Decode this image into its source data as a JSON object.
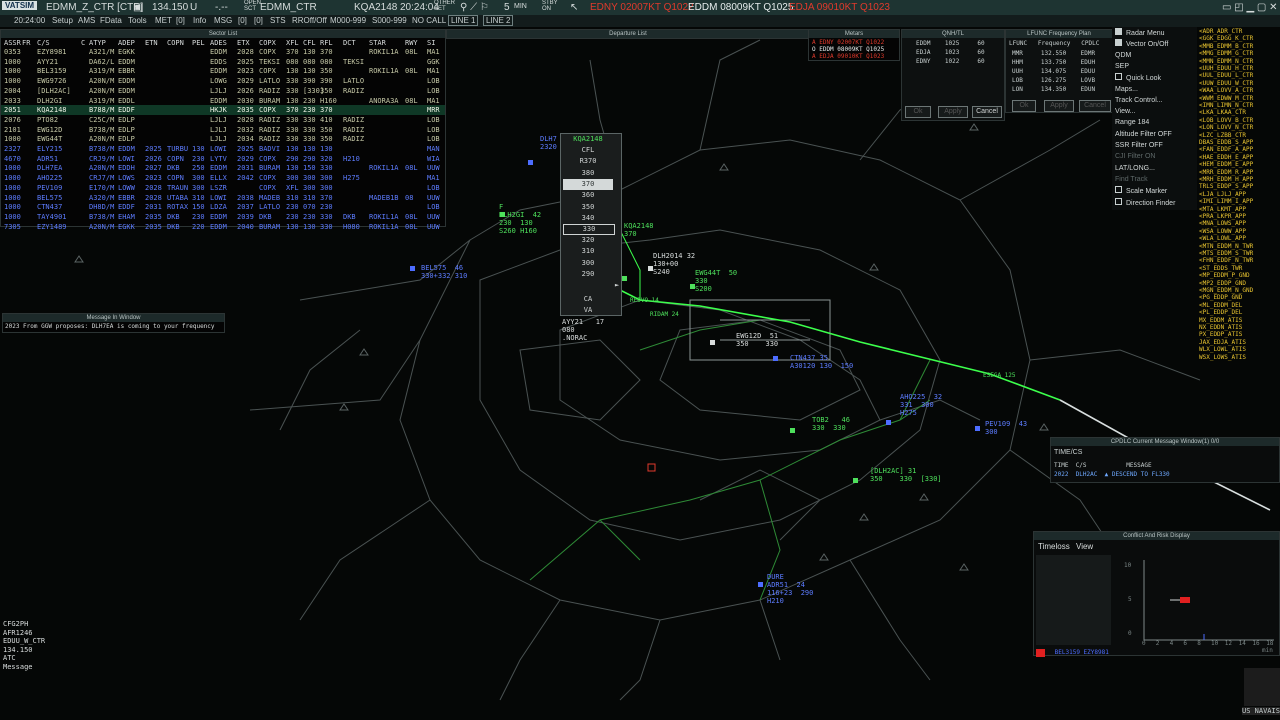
{
  "topbar": {
    "logo": "VATSIM",
    "position": "EDMM_Z_CTR [CTR]",
    "frequency": "134.150",
    "freq_unit": "U",
    "dash": "-.--",
    "sct": "EDMM_CTR",
    "callsign": "KQA2148",
    "time": "20:24:04",
    "qnh_ind": "5",
    "min": "MIN",
    "metars": [
      {
        "text": "EDNY 02007KT Q1022",
        "color": "#e03a2c"
      },
      {
        "text": "EDDM 08009KT Q1025",
        "color": "#e6ecec"
      },
      {
        "text": "EDJA 09010KT Q1023",
        "color": "#e03a2c"
      }
    ]
  },
  "menubar": {
    "utc": "20:24:00",
    "items": [
      "Setup",
      "AMS",
      "FData",
      "Tools",
      "MET",
      "[0]",
      "Info",
      "MSG",
      "[0]",
      "[0]",
      "STS",
      "RROff/Off",
      "M000-999",
      "S000-999",
      "NO CALL",
      "LINE 1",
      "LINE 2"
    ]
  },
  "sector_list": {
    "title": "Sector List",
    "headers": [
      "ASSR",
      "FR",
      "C/S",
      "C",
      "ATYP",
      "ADEP",
      "ETN",
      "COPN",
      "PEL",
      "ADES",
      "ETX",
      "COPX",
      "XFL",
      "CFL",
      "RFL",
      "DCT",
      "STAR",
      "RWY",
      "SI"
    ],
    "rows": [
      {
        "c": "w",
        "selected": false,
        "cells": [
          "0353",
          "",
          "EZY8981",
          "",
          "A321/M",
          "EGKK",
          "",
          "",
          "",
          "EDDM",
          "2028",
          "COPX",
          "370",
          "130",
          "370",
          "",
          "ROKIL1A",
          "08L",
          "MA1"
        ]
      },
      {
        "c": "w",
        "selected": false,
        "cells": [
          "1000",
          "",
          "AYY21",
          "",
          "DA62/L",
          "EDDM",
          "",
          "",
          "",
          "EDDS",
          "2025",
          "TEKSI",
          "080",
          "080",
          "080",
          "TEKSI",
          "",
          "",
          "GGK"
        ]
      },
      {
        "c": "w",
        "selected": false,
        "cells": [
          "1000",
          "",
          "BEL3159",
          "",
          "A319/M",
          "EBBR",
          "",
          "",
          "",
          "EDDM",
          "2023",
          "COPX",
          "130",
          "130",
          "350",
          "",
          "ROKIL1A",
          "08L",
          "MA1"
        ]
      },
      {
        "c": "w",
        "selected": false,
        "cells": [
          "1000",
          "",
          "EWG9726",
          "",
          "A20N/M",
          "EDDM",
          "",
          "",
          "",
          "LOWG",
          "2029",
          "LATLO",
          "330",
          "390",
          "390",
          "LATLO",
          "",
          "",
          "LOB"
        ]
      },
      {
        "c": "w",
        "selected": false,
        "cells": [
          "2004",
          "",
          "[DLH2AC]",
          "",
          "A20N/M",
          "EDDM",
          "",
          "",
          "",
          "LJLJ",
          "2026",
          "RADIZ",
          "330",
          "[330]",
          "350",
          "RADIZ",
          "",
          "",
          "LOB"
        ]
      },
      {
        "c": "w",
        "selected": false,
        "cells": [
          "2033",
          "",
          "DLH2GI",
          "",
          "A319/M",
          "EDDL",
          "",
          "",
          "",
          "EDDM",
          "2030",
          "BURAM",
          "130",
          "230",
          "H160",
          "",
          "ANORA3A",
          "08L",
          "MA1"
        ]
      },
      {
        "c": "w",
        "selected": true,
        "cells": [
          "2051",
          "",
          "KQA2148",
          "",
          "B788/M",
          "EDDF",
          "",
          "",
          "",
          "HKJK",
          "2035",
          "COPX",
          "370",
          "230",
          "370",
          "",
          "",
          "",
          "MRR"
        ]
      },
      {
        "c": "w",
        "selected": false,
        "cells": [
          "2076",
          "",
          "PTO82",
          "",
          "C25C/M",
          "EDLP",
          "",
          "",
          "",
          "LJLJ",
          "2028",
          "RADIZ",
          "330",
          "330",
          "410",
          "RADIZ",
          "",
          "",
          "LOB"
        ]
      },
      {
        "c": "w",
        "selected": false,
        "cells": [
          "2101",
          "",
          "EWG12D",
          "",
          "B738/M",
          "EDLP",
          "",
          "",
          "",
          "LJLJ",
          "2032",
          "RADIZ",
          "330",
          "330",
          "350",
          "RADIZ",
          "",
          "",
          "LOB"
        ]
      },
      {
        "c": "w",
        "selected": false,
        "cells": [
          "1000",
          "",
          "EWG44T",
          "",
          "A20N/M",
          "EDLP",
          "",
          "",
          "",
          "LJLJ",
          "2034",
          "RADIZ",
          "330",
          "330",
          "350",
          "RADIZ",
          "",
          "",
          "LOB"
        ]
      },
      {
        "c": "b",
        "selected": false,
        "cells": [
          "2327",
          "",
          "ELY215",
          "",
          "B738/M",
          "EDDM",
          "2025",
          "TURBU",
          "130",
          "LOWI",
          "2025",
          "BADVI",
          "130",
          "130",
          "130",
          "",
          "",
          "",
          "MAN"
        ]
      },
      {
        "c": "b",
        "selected": false,
        "cells": [
          "4670",
          "",
          "ADR51",
          "",
          "CRJ9/M",
          "LOWI",
          "2026",
          "COPN",
          "230",
          "LYTV",
          "2029",
          "COPX",
          "290",
          "290",
          "320",
          "H210",
          "",
          "",
          "WIA"
        ]
      },
      {
        "c": "b",
        "selected": false,
        "cells": [
          "1000",
          "",
          "DLH7EA",
          "",
          "A20N/M",
          "EDDH",
          "2027",
          "DKB",
          "250",
          "EDDM",
          "2031",
          "BURAM",
          "130",
          "150",
          "330",
          "",
          "ROKIL1A",
          "08L",
          "UUW"
        ]
      },
      {
        "c": "b",
        "selected": false,
        "cells": [
          "1000",
          "",
          "AHO225",
          "",
          "CRJ7/M",
          "LOWS",
          "2023",
          "COPN",
          "300",
          "ELLX",
          "2042",
          "COPX",
          "300",
          "300",
          "300",
          "H275",
          "",
          "",
          "MA1"
        ]
      },
      {
        "c": "b",
        "selected": false,
        "cells": [
          "1000",
          "",
          "PEV109",
          "",
          "E170/M",
          "LOWW",
          "2028",
          "TRAUN",
          "300",
          "LSZR",
          "",
          "COPX",
          "XFL",
          "300",
          "300",
          "",
          "",
          "",
          "LOB"
        ]
      },
      {
        "c": "b",
        "selected": false,
        "cells": [
          "1000",
          "",
          "BEL575",
          "",
          "A320/M",
          "EBBR",
          "2028",
          "UTABA",
          "310",
          "LOWI",
          "2038",
          "MADEB",
          "310",
          "310",
          "370",
          "",
          "MADEB1B",
          "08",
          "UUW"
        ]
      },
      {
        "c": "b",
        "selected": false,
        "cells": [
          "1000",
          "",
          "CTN437",
          "",
          "DH8D/M",
          "EDDF",
          "2031",
          "ROTAX",
          "150",
          "LDZA",
          "2037",
          "LATLO",
          "230",
          "070",
          "230",
          "",
          "",
          "",
          "LOB"
        ]
      },
      {
        "c": "b",
        "selected": false,
        "cells": [
          "1000",
          "",
          "TAY4901",
          "",
          "B738/M",
          "EHAM",
          "2035",
          "DKB",
          "230",
          "EDDM",
          "2039",
          "DKB",
          "230",
          "230",
          "330",
          "DKB",
          "ROKIL1A",
          "08L",
          "UUW"
        ]
      },
      {
        "c": "b",
        "selected": false,
        "cells": [
          "7305",
          "",
          "EZY1489",
          "",
          "A20N/M",
          "EGKK",
          "2035",
          "DKB",
          "220",
          "EDDM",
          "2040",
          "BURAM",
          "130",
          "130",
          "330",
          "H080",
          "ROKIL1A",
          "08L",
          "UUW"
        ]
      }
    ]
  },
  "departure_list": {
    "title": "Departure List"
  },
  "metar_window": {
    "title": "Metars",
    "lines": [
      {
        "text": "A EDNY 02007KT Q1022",
        "color": "#e03a2c"
      },
      {
        "text": "O EDDM 08009KT Q1025",
        "color": "#e6ecec"
      },
      {
        "text": "A EDJA 09010KT Q1023",
        "color": "#e03a2c"
      }
    ]
  },
  "qnh_window": {
    "title": "QNH/TL",
    "rows": [
      [
        "EDDM",
        "1025",
        "60"
      ],
      [
        "EDJA",
        "1023",
        "60"
      ],
      [
        "EDNY",
        "1022",
        "60"
      ]
    ],
    "ok": "Ok",
    "apply": "Apply",
    "cancel": "Cancel"
  },
  "freq_plan": {
    "title": "LFUNC Frequency Plan",
    "headers": [
      "LFUNC",
      "Frequency",
      "CPDLC"
    ],
    "rows": [
      [
        "MMR",
        "132.550",
        "EDMR"
      ],
      [
        "HHM",
        "133.750",
        "EDUH"
      ],
      [
        "UUH",
        "134.075",
        "EDUU"
      ],
      [
        "LOB",
        "126.275",
        "LOVB"
      ],
      [
        "LON",
        "134.350",
        "EDUN"
      ]
    ],
    "ok": "Ok",
    "apply": "Apply",
    "cancel": "Cancel"
  },
  "radar_menu": {
    "items": [
      {
        "label": "Radar Menu",
        "check": true
      },
      {
        "label": "Vector On/Off",
        "check": true
      },
      {
        "label": "QDM",
        "check": false
      },
      {
        "label": "SEP",
        "check": false
      },
      {
        "label": "Quick Look",
        "check": true
      },
      {
        "label": "Maps...",
        "check": false
      },
      {
        "label": "Track Control...",
        "check": false
      },
      {
        "label": "View...",
        "check": false
      },
      {
        "label": "Range 184",
        "check": false
      },
      {
        "label": "Altitude Filter OFF",
        "check": false
      },
      {
        "label": "SSR Filter OFF",
        "check": false
      },
      {
        "label": "CJI Filter ON",
        "check": false
      },
      {
        "label": "LAT/LONG...",
        "check": false
      },
      {
        "label": "Find Track",
        "check": false
      },
      {
        "label": "Scale Marker",
        "check": true
      },
      {
        "label": "Direction Finder",
        "check": true
      }
    ]
  },
  "freq_list": [
    "<ADR_ADR_CTR",
    "<GGK_EDGG_K_CTR",
    "<MMB_EDMM_B_CTR",
    "<MMG_EDMM_G_CTR",
    "<MMN_EDMM_N_CTR",
    "<UUH_EDUU_H_CTR",
    "<UUL_EDUU_L_CTR",
    "<UUW_EDUU_W_CTR",
    "<WAA_LOVV_A_CTR",
    "<WWM_EDWW_M_CTR",
    "<IMN_LIMN_N_CTR",
    "<LKA_LKAA_CTR",
    "<LOB_LOVV_B_CTR",
    "<LON_LOVV_N_CTR",
    "<LZC_LZBB_CTR",
    "DBAS_EDDB_S_APP",
    "<FAN_EDDF_A_APP",
    "<HAE_EDDH_E_APP",
    "<HEM_EDDM_E_APP",
    "<MRR_EDDM_R_APP",
    "<MRH_EDDM_H_APP",
    "TRLS_EDDP_S_APP",
    "<LJA_LJLJ_APP",
    "<IMI_LIMM_I_APP",
    "<MTA_LKMT_APP",
    "<PRA_LKPR_APP",
    "<MNA_LOWS_APP",
    "<WSA_LOWW_APP",
    "<WLA_LOWL_APP",
    "<MTN_EDDM_N_TWR",
    "<MTS_EDDM_S_TWR",
    "<FHN_EDDF_N_TWR",
    "<ST_EDDS_TWR",
    "<MP_EDDM_P_GND",
    "<MP2_EDDP_GND",
    "<MGN_EDDM_N_GND",
    "<PG_EDDP_GND",
    "<ML_EDDM_DEL",
    "<PL_EDDP_DEL",
    "MX_EDDM_ATIS",
    "NX_EDDN_ATIS",
    "PX_EDDP_ATIS",
    "JAX_EDJA_ATIS",
    "WLX_LOWL_ATIS",
    "WSX_LOWS_ATIS"
  ],
  "cfl_menu": {
    "title": "KQA2148",
    "header": "CFL",
    "r_item": "R370",
    "levels": [
      "380",
      "370",
      "360",
      "350",
      "340",
      "330",
      "320",
      "310",
      "300",
      "290"
    ],
    "highlight": "370",
    "boxed": "330",
    "ca": "CA",
    "va": "VA"
  },
  "msg_window": {
    "title": "Message In Window",
    "text": "2023 From GGW proposes: DLH7EA is coming to your frequency"
  },
  "cpdlc": {
    "title": "CPDLC Current Message Window(1) 0/0",
    "sub": "TIME/CS",
    "headers": [
      "TIME",
      "C/S",
      "",
      "MESSAGE"
    ],
    "row": [
      "2022",
      "DLH2AC",
      "▲",
      "DESCEND TO FL330"
    ]
  },
  "conflict": {
    "title": "Conflict And Risk Display",
    "tabs": [
      "Timeloss",
      "View"
    ],
    "pair": "BEL3159 EZY8981",
    "y_ticks": [
      "10",
      "5",
      "0"
    ],
    "x_ticks": [
      "0",
      "2",
      "4",
      "6",
      "8",
      "10",
      "12",
      "14",
      "16",
      "18"
    ],
    "x_unit": "min"
  },
  "bottom_left": [
    "CFG2PH",
    "AFR1246",
    "EDUU_W_CTR",
    "134.150",
    "ATC",
    "Message"
  ],
  "corner_text": "US NAVAIS",
  "tracks": [
    {
      "id": "bel575",
      "color": "b",
      "lines": [
        "BEL575  46",
        "330+332 310"
      ]
    },
    {
      "id": "dlh2gi",
      "color": "g",
      "lines": [
        "F",
        "DLH2GI  42",
        "230  130",
        "S260 H160"
      ]
    },
    {
      "id": "kqa",
      "color": "g",
      "lines": [
        "KQA2148",
        "370"
      ]
    },
    {
      "id": "dlh2014",
      "color": "w",
      "lines": [
        "DLH2014 32",
        "130+00",
        "S240"
      ]
    },
    {
      "id": "ewg44t",
      "color": "g",
      "lines": [
        "EWG44T  50",
        "330",
        "S200"
      ]
    },
    {
      "id": "ewg12d",
      "color": "w",
      "lines": [
        "EWG12D  51",
        "350    330"
      ]
    },
    {
      "id": "ayy21",
      "color": "w",
      "lines": [
        "AYY21   17",
        "080",
        ".NORAC"
      ]
    },
    {
      "id": "ctn",
      "color": "b",
      "lines": [
        "CTN437 35",
        "A30120 130  150"
      ]
    },
    {
      "id": "tob2",
      "color": "g",
      "lines": [
        "TOB2   46",
        "330  330"
      ]
    },
    {
      "id": "aho",
      "color": "b",
      "lines": [
        "AHO225  32",
        "331  300",
        "H275"
      ]
    },
    {
      "id": "pev",
      "color": "b",
      "lines": [
        "PEV109  43",
        "300"
      ]
    },
    {
      "id": "dlh2ac",
      "color": "g",
      "lines": [
        "[DLH2AC] 31",
        "350    330  [330]"
      ]
    },
    {
      "id": "adr51",
      "color": "b",
      "lines": [
        "DURE",
        "ADR51  24",
        "116+23  290",
        "H210"
      ]
    },
    {
      "id": "dlh7",
      "color": "b",
      "lines": [
        "DLH7",
        "2320"
      ]
    }
  ],
  "route_labels": [
    "ESEGA 125",
    "REDVO 14",
    "RIDAM 24"
  ],
  "cfl_nav": "►"
}
